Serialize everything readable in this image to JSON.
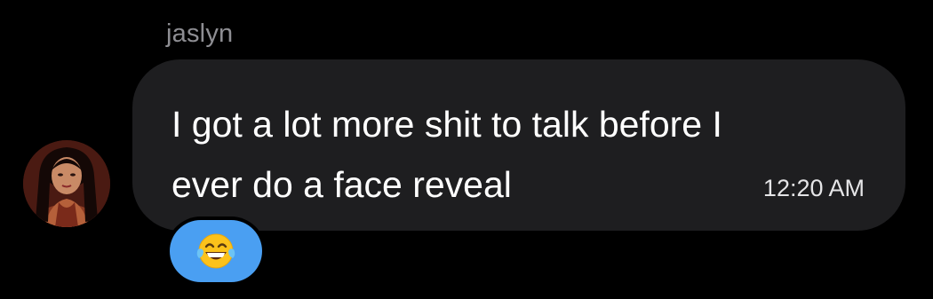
{
  "message": {
    "sender": "jaslyn",
    "text": "I got a lot more shit to talk before I\never do a face reveal",
    "time": "12:20 AM"
  },
  "avatar": {
    "icon": "profile-photo"
  },
  "reaction": {
    "icon": "face-with-tears-of-joy-icon",
    "color": "#4a9ff2"
  },
  "colors": {
    "background": "#000000",
    "bubble": "#1e1e20",
    "sender_name": "#8e8e93",
    "text": "#ffffff"
  }
}
